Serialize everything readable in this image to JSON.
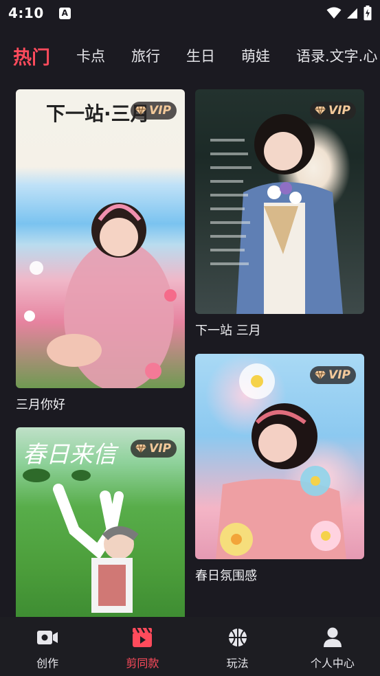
{
  "status_bar": {
    "time": "4:10",
    "notification_glyph": "A"
  },
  "tabs": [
    {
      "label": "热门",
      "active": true
    },
    {
      "label": "卡点",
      "active": false
    },
    {
      "label": "旅行",
      "active": false
    },
    {
      "label": "生日",
      "active": false
    },
    {
      "label": "萌娃",
      "active": false
    },
    {
      "label": "语录.文字.心",
      "active": false
    }
  ],
  "cards": [
    {
      "title": "三月你好",
      "badge": "VIP",
      "image_text": "下一站·三月",
      "image_alt": "girl-in-flower-field-photo"
    },
    {
      "title": "下一站 三月",
      "badge": "VIP",
      "image_alt": "girl-with-bouquet-photo"
    },
    {
      "title": "",
      "badge": "VIP",
      "image_text": "春日来信",
      "image_alt": "girl-on-lawn-photo"
    },
    {
      "title": "春日氛围感",
      "badge": "VIP",
      "image_alt": "girl-with-balloon-flowers-photo"
    }
  ],
  "bottom_nav": [
    {
      "label": "创作",
      "icon": "video-camera-icon",
      "active": false
    },
    {
      "label": "剪同款",
      "icon": "clapperboard-icon",
      "active": true
    },
    {
      "label": "玩法",
      "icon": "basketball-icon",
      "active": false
    },
    {
      "label": "个人中心",
      "icon": "person-icon",
      "active": false
    }
  ],
  "colors": {
    "accent": "#ff4b5c",
    "background": "#1b1a21",
    "vip_gold": "#f3c99a"
  }
}
